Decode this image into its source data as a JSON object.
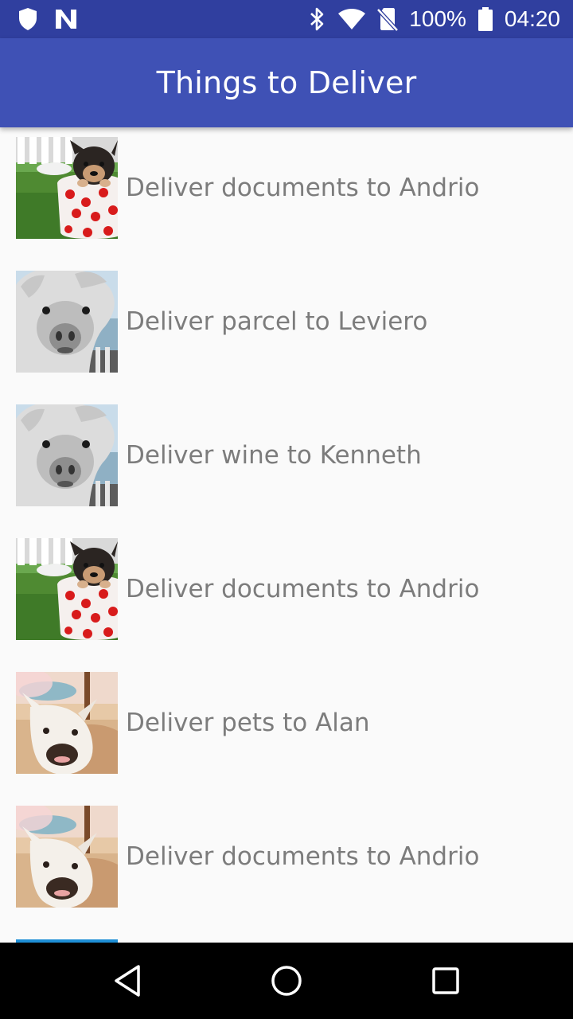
{
  "status_bar": {
    "battery_text": "100%",
    "time": "04:20",
    "icons": [
      "shield-icon",
      "n-notification-icon",
      "bluetooth-icon",
      "wifi-icon",
      "no-sim-icon",
      "battery-icon"
    ]
  },
  "app_bar": {
    "title": "Things to Deliver",
    "color": "#3f51b5",
    "status_color": "#303f9f"
  },
  "deliveries": [
    {
      "label": "Deliver documents to Andrio",
      "image": "puppy-in-cup-image"
    },
    {
      "label": "Deliver parcel to Leviero",
      "image": "alpaca-image"
    },
    {
      "label": "Deliver wine to Kenneth",
      "image": "alpaca-image"
    },
    {
      "label": "Deliver documents to Andrio",
      "image": "puppy-in-cup-image"
    },
    {
      "label": "Deliver pets to Alan",
      "image": "white-dog-image"
    },
    {
      "label": "Deliver documents to Andrio",
      "image": "white-dog-image"
    }
  ],
  "nav_bar": {
    "icons": [
      "back-icon",
      "home-icon",
      "recents-icon"
    ]
  }
}
